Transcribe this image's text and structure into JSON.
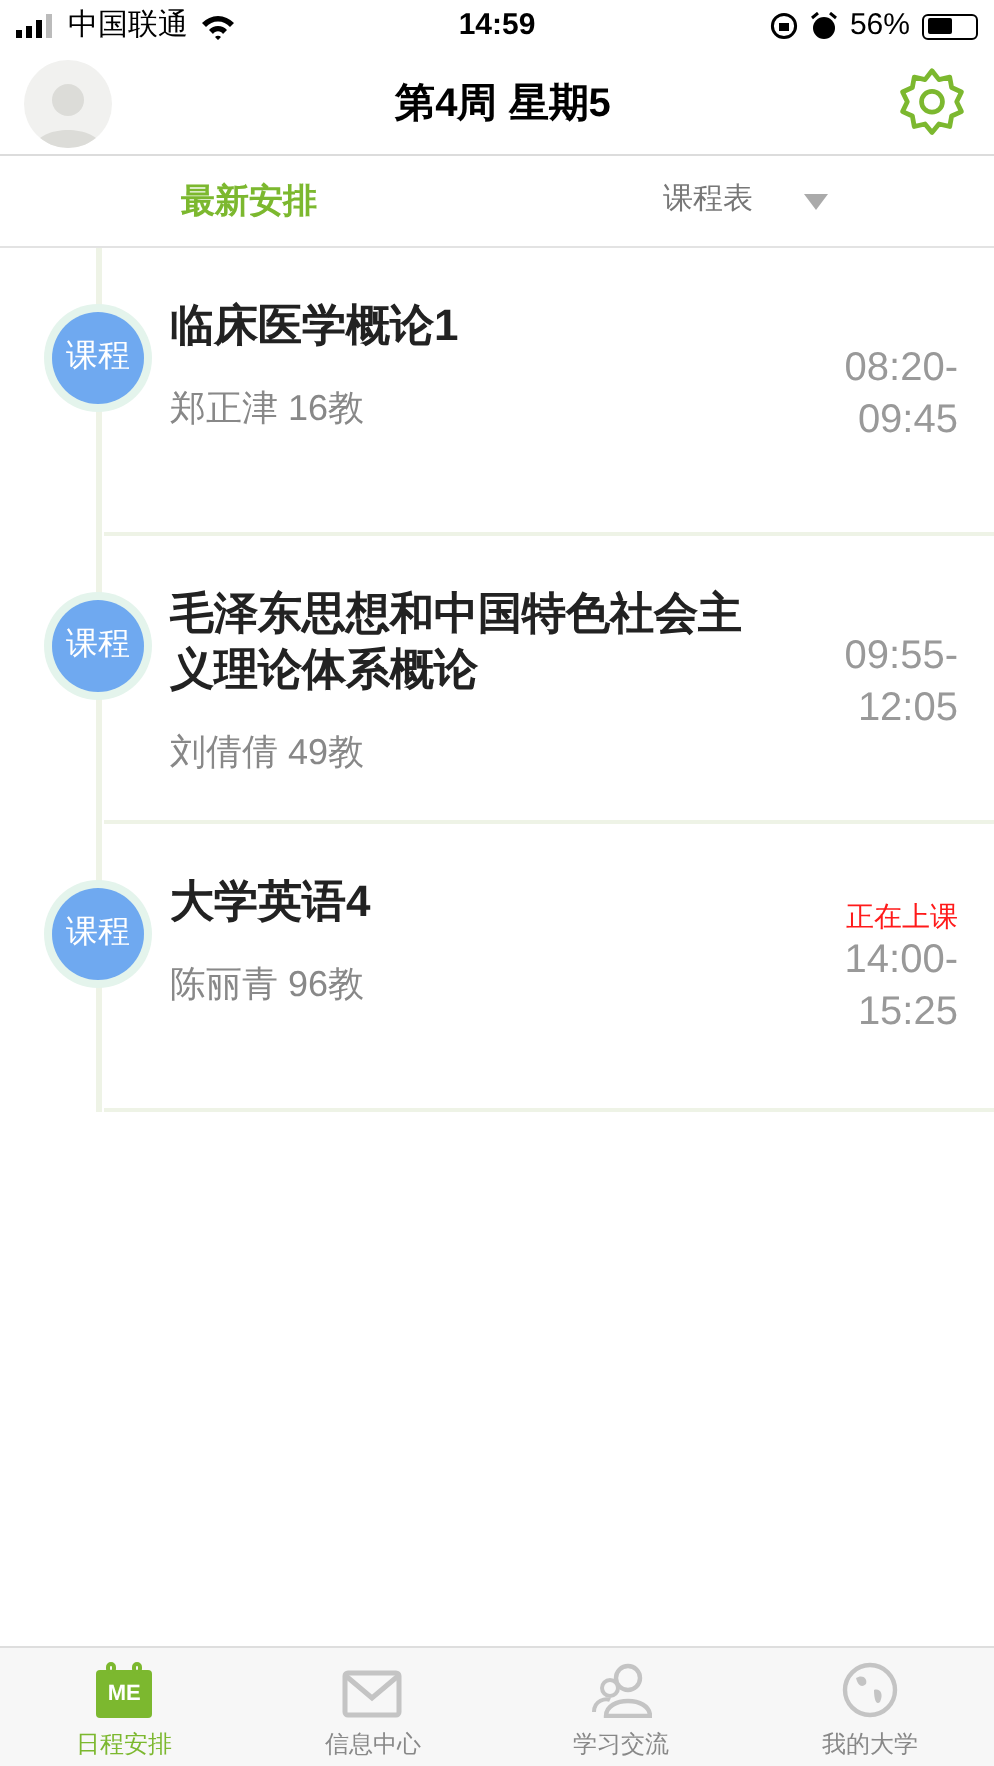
{
  "status_bar": {
    "carrier": "中国联通",
    "time": "14:59",
    "battery_percent": "56%"
  },
  "header": {
    "title": "第4周 星期5"
  },
  "tabs": [
    {
      "label": "最新安排",
      "selected": true,
      "dropdown": false
    },
    {
      "label": "课程表",
      "selected": false,
      "dropdown": true
    }
  ],
  "courses": [
    {
      "badge": "课程",
      "name": "临床医学概论1",
      "teacher": "郑正津 16教",
      "start": "08:20-",
      "end": "09:45"
    },
    {
      "badge": "课程",
      "name": "毛泽东思想和中国特色社会主义理论体系概论",
      "teacher": "刘倩倩 49教",
      "start": "09:55-",
      "end": "12:05"
    },
    {
      "badge": "课程",
      "name": "大学英语4",
      "teacher": "陈丽青 96教",
      "status": "正在上课",
      "start": "14:00-",
      "end": "15:25"
    }
  ],
  "bottom_nav": [
    {
      "kind": "calendar",
      "icon_text": "ME",
      "label": "日程安排",
      "selected": true
    },
    {
      "kind": "mail",
      "label": "信息中心",
      "selected": false
    },
    {
      "kind": "people",
      "label": "学习交流",
      "selected": false
    },
    {
      "kind": "globe",
      "label": "我的大学",
      "selected": false
    }
  ]
}
